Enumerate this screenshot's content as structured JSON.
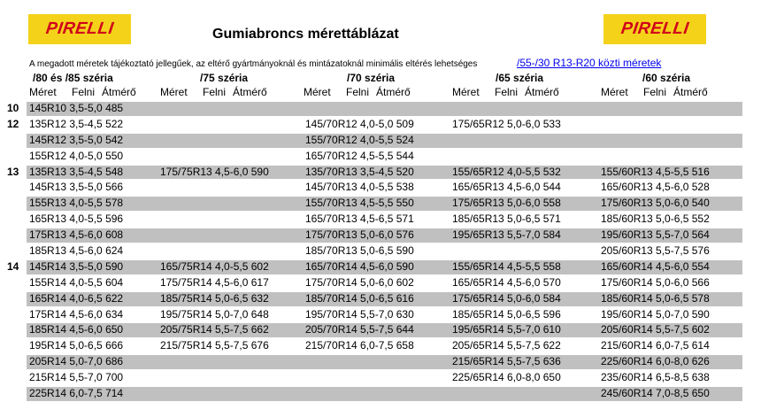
{
  "logo_text": "PIRELLI",
  "title": "Gumiabroncs mérettáblázat",
  "note": "A megadott méretek tájékoztató jellegűek, az eltérő gyártmányoknál és mintázatoknál minimális eltérés lehetséges",
  "link_text": "/55-/30 R13-R20 közti méretek",
  "series_headers": [
    "/80 és /85 széria",
    "/75 széria",
    "/70 széria",
    "/65 széria",
    "/60 széria"
  ],
  "column_labels": [
    "Méret",
    "Felni",
    "Átmérő"
  ],
  "rows": [
    {
      "rim": "10",
      "shaded": true,
      "cells": [
        "145R10 3,5-5,0 485",
        "",
        "",
        "",
        ""
      ]
    },
    {
      "rim": "12",
      "shaded": false,
      "cells": [
        "135R12 3,5-4,5 522",
        "",
        "145/70R12 4,0-5,0 509",
        "175/65R12 5,0-6,0 533",
        ""
      ]
    },
    {
      "rim": "",
      "shaded": true,
      "cells": [
        "145R12 3,5-5,0 542",
        "",
        "155/70R12 4,0-5,5 524",
        "",
        ""
      ]
    },
    {
      "rim": "",
      "shaded": false,
      "cells": [
        "155R12 4,0-5,0 550",
        "",
        "165/70R12 4,5-5,5 544",
        "",
        ""
      ]
    },
    {
      "rim": "13",
      "shaded": true,
      "cells": [
        "135R13 3,5-4,5 548",
        "175/75R13 4,5-6,0 590",
        "135/70R13 3,5-4,5 520",
        "155/65R12 4,0-5,5 532",
        "155/60R13 4,5-5,5 516"
      ]
    },
    {
      "rim": "",
      "shaded": false,
      "cells": [
        "145R13 3,5-5,0 566",
        "",
        "145/70R13 4,0-5,5 538",
        "165/65R13 4,5-6,0 544",
        "165/60R13 4,5-6,0 528"
      ]
    },
    {
      "rim": "",
      "shaded": true,
      "cells": [
        "155R13 4,0-5,5 578",
        "",
        "155/70R13 4,5-5,5 550",
        "175/65R13 5,0-6,0 558",
        "175/60R13 5,0-6,0 540"
      ]
    },
    {
      "rim": "",
      "shaded": false,
      "cells": [
        "165R13 4,0-5,5 596",
        "",
        "165/70R13 4,5-6,5 571",
        "185/65R13 5,0-6,5 571",
        "185/60R13 5,0-6,5 552"
      ]
    },
    {
      "rim": "",
      "shaded": true,
      "cells": [
        "175R13 4,5-6,0 608",
        "",
        "175/70R13 5,0-6,0 576",
        "195/65R13 5,5-7,0 584",
        "195/60R13 5,5-7,0 564"
      ]
    },
    {
      "rim": "",
      "shaded": false,
      "cells": [
        "185R13 4,5-6,0 624",
        "",
        "185/70R13 5,0-6,5 590",
        "",
        "205/60R13 5,5-7,5 576"
      ]
    },
    {
      "rim": "14",
      "shaded": true,
      "cells": [
        "145R14 3,5-5,0 590",
        "165/75R14 4,0-5,5 602",
        "165/70R14 4,5-6,0 590",
        "155/65R14 4,5-5,5 558",
        "165/60R14 4,5-6,0 554"
      ]
    },
    {
      "rim": "",
      "shaded": false,
      "cells": [
        "155R14 4,0-5,5 604",
        "175/75R14 4,5-6,0 617",
        "175/70R14 5,0-6,0 602",
        "165/65R14 4,5-6,0 570",
        "175/60R14 5,0-6,0 566"
      ]
    },
    {
      "rim": "",
      "shaded": true,
      "cells": [
        "165R14 4,0-6,5 622",
        "185/75R14 5,0-6,5 632",
        "185/70R14 5,0-6,5 616",
        "175/65R14 5,0-6,0 584",
        "185/60R14 5,0-6,5 578"
      ]
    },
    {
      "rim": "",
      "shaded": false,
      "cells": [
        "175R14 4,5-6,0 634",
        "195/75R14 5,0-7,0 648",
        "195/70R14 5,5-7,0 630",
        "185/65R14 5,0-6,5 596",
        "195/60R14 5,0-7,0 590"
      ]
    },
    {
      "rim": "",
      "shaded": true,
      "cells": [
        "185R14 4,5-6,0 650",
        "205/75R14 5,5-7,5 662",
        "205/70R14 5,5-7,5 644",
        "195/65R14 5,5-7,0 610",
        "205/60R14 5,5-7,5 602"
      ]
    },
    {
      "rim": "",
      "shaded": false,
      "cells": [
        "195R14 5,0-6,5 666",
        "215/75R14 5,5-7,5 676",
        "215/70R14 6,0-7,5 658",
        "205/65R14 5,5-7,5 622",
        "215/60R14 6,0-7,5 614"
      ]
    },
    {
      "rim": "",
      "shaded": true,
      "cells": [
        "205R14 5,0-7,0 686",
        "",
        "",
        "215/65R14 5,5-7,5 636",
        "225/60R14 6,0-8,0 626"
      ]
    },
    {
      "rim": "",
      "shaded": false,
      "cells": [
        "215R14 5,5-7,0 700",
        "",
        "",
        "225/65R14 6,0-8,0 650",
        "235/60R14 6,5-8,5 638"
      ]
    },
    {
      "rim": "",
      "shaded": true,
      "cells": [
        "225R14 6,0-7,5 714",
        "",
        "",
        "",
        "245/60R14 7,0-8,5 650"
      ]
    }
  ]
}
